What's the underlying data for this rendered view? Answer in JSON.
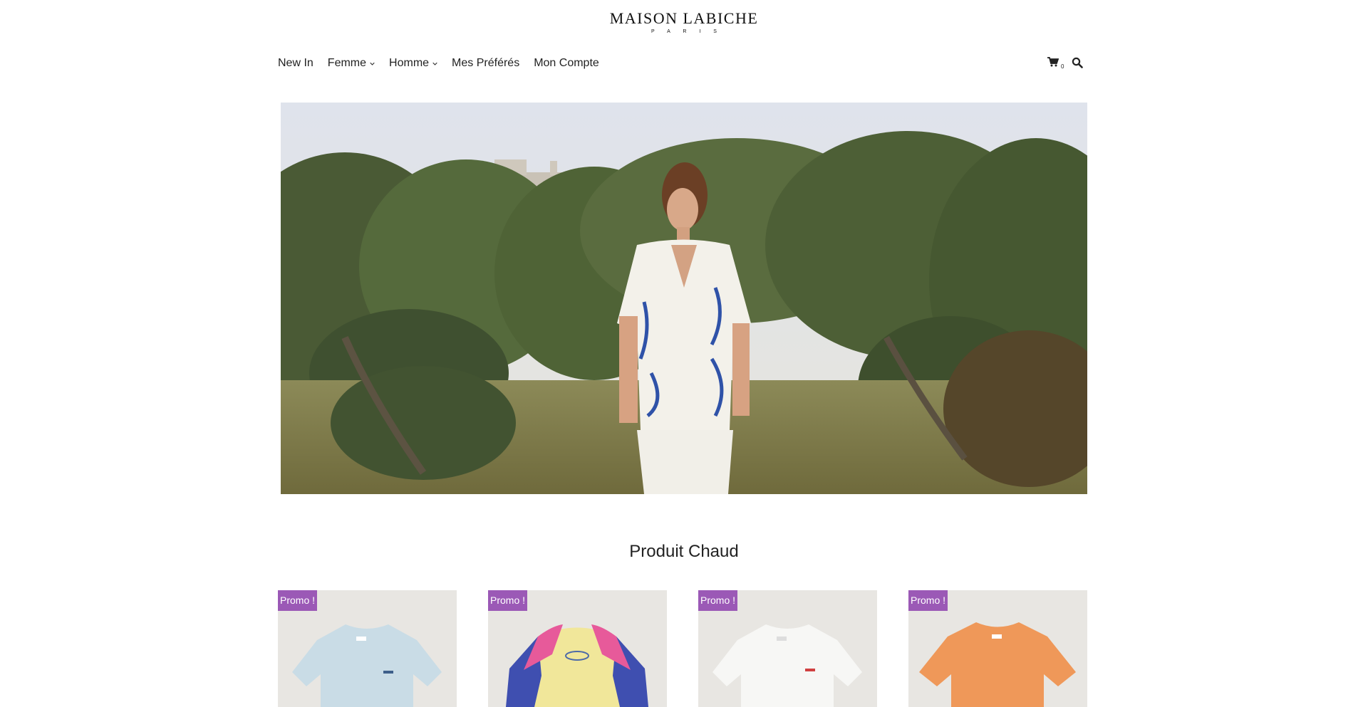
{
  "brand": {
    "name": "MAISON LABICHE",
    "tagline": "P A R I S"
  },
  "nav": {
    "items": [
      {
        "label": "New In",
        "has_dropdown": false
      },
      {
        "label": "Femme",
        "has_dropdown": true
      },
      {
        "label": "Homme",
        "has_dropdown": true
      },
      {
        "label": "Mes Préférés",
        "has_dropdown": false
      },
      {
        "label": "Mon Compte",
        "has_dropdown": false
      }
    ],
    "cart_count": "0",
    "cart_icon": "shopping-cart-icon",
    "search_icon": "search-icon"
  },
  "hero": {
    "image": "man-in-white-printed-shirt-olive-grove"
  },
  "section": {
    "title": "Produit Chaud"
  },
  "products": [
    {
      "badge": "Promo !",
      "color": "#c9dce6",
      "image": "light-blue-tshirt"
    },
    {
      "badge": "Promo !",
      "color": "#f1e79a",
      "image": "colorblock-sweatshirt-yellow-pink-blue"
    },
    {
      "badge": "Promo !",
      "color": "#f7f7f5",
      "image": "white-tshirt"
    },
    {
      "badge": "Promo !",
      "color": "#ef9859",
      "image": "orange-tshirt"
    }
  ],
  "colors": {
    "promo_badge": "#9b59b6",
    "card_bg": "#e8e6e2"
  }
}
